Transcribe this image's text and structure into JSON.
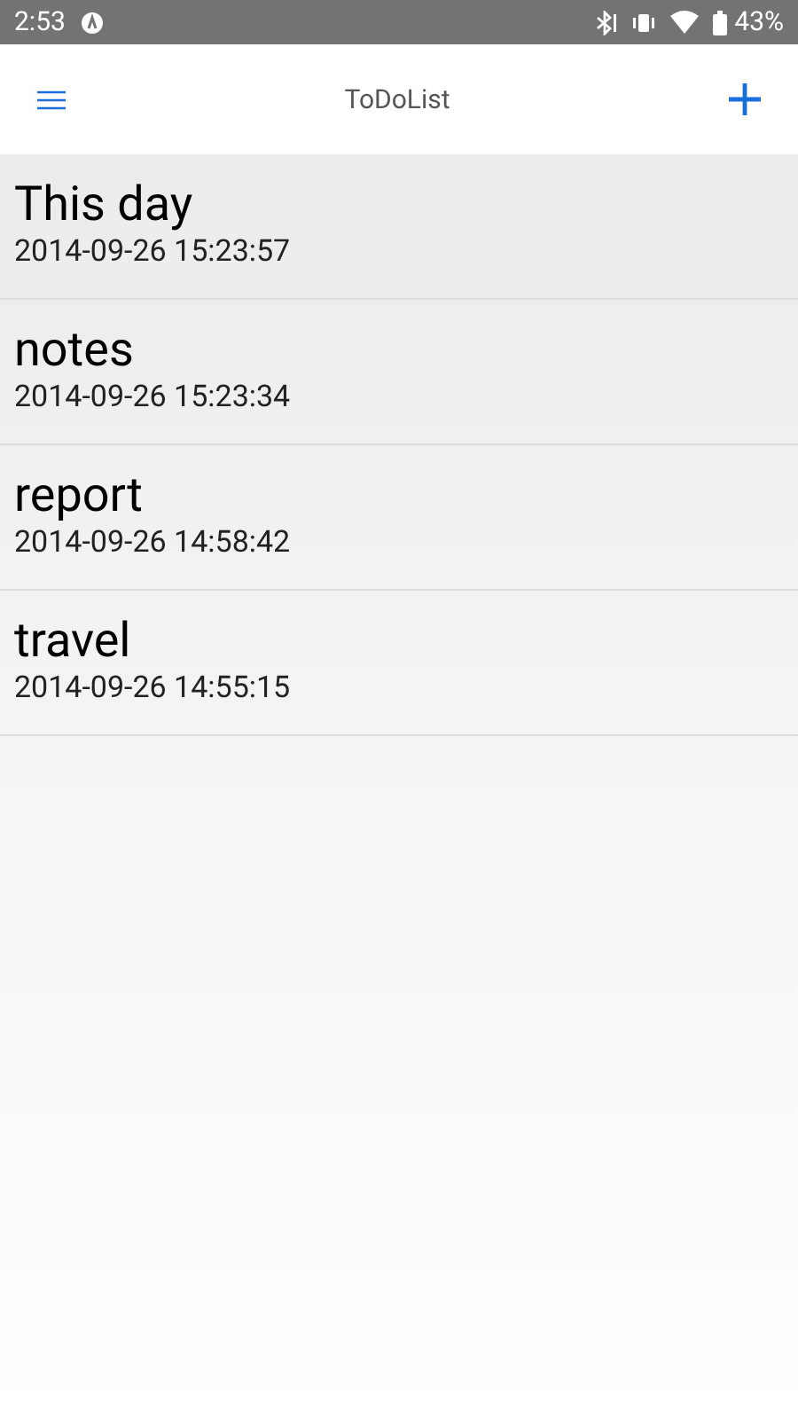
{
  "status_bar": {
    "time": "2:53",
    "battery": "43%"
  },
  "app_bar": {
    "title": "ToDoList"
  },
  "notes": [
    {
      "title": "This day",
      "date": "2014-09-26 15:23:57"
    },
    {
      "title": "notes",
      "date": "2014-09-26 15:23:34"
    },
    {
      "title": "report",
      "date": "2014-09-26 14:58:42"
    },
    {
      "title": "travel",
      "date": "2014-09-26 14:55:15"
    }
  ]
}
